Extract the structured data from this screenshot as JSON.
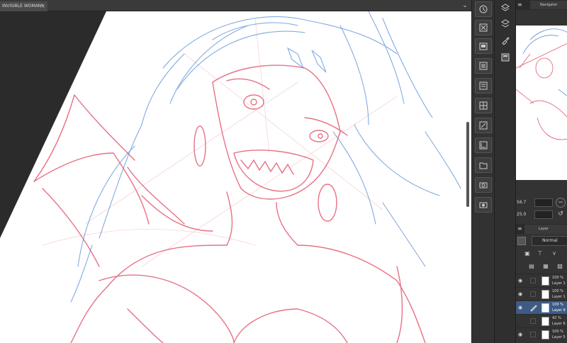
{
  "document": {
    "tab_label": "INVISIBLE WOMAN*",
    "close_glyph": "×",
    "chevron_glyph": "⌄"
  },
  "navigator": {
    "tab_label": "Navigator",
    "menu_glyph": "≡",
    "zoom_value": "56.7",
    "rotate_value": "25.0",
    "zoom_out_glyph": "−",
    "rotate_reset_glyph": "↺"
  },
  "layers_panel": {
    "tab_label": "Layer",
    "menu_glyph": "≡",
    "blend_mode": "Normal",
    "blend_chevron": "⌄",
    "layers": [
      {
        "opacity": "100 %",
        "name": "Layer 1",
        "selected": false,
        "edit": false
      },
      {
        "opacity": "100 %",
        "name": "Layer 1",
        "selected": false,
        "edit": false
      },
      {
        "opacity": "100 %",
        "name": "Layer 9",
        "selected": true,
        "edit": true
      },
      {
        "opacity": "42 %",
        "name": "Layer 6",
        "selected": false,
        "edit": false
      },
      {
        "opacity": "100 %",
        "name": "Layer 5",
        "selected": false,
        "edit": false
      }
    ]
  },
  "icons": {
    "tools": [
      "rotate-view-icon",
      "new-layer-icon",
      "layer-folder-icon",
      "copy-layer-icon",
      "merge-layer-icon",
      "grid-icon",
      "layer-property-icon",
      "ruler-icon",
      "folder-icon",
      "camera-icon",
      "camera-alt-icon",
      "export-icon"
    ],
    "side": [
      "layers-stack-icon",
      "layers-alt-icon",
      "brush-icon",
      "preview-icon"
    ]
  },
  "colors": {
    "red_sketch": "#e2596f",
    "blue_sketch": "#5b8fd6",
    "selected_layer": "#3e5b86"
  }
}
